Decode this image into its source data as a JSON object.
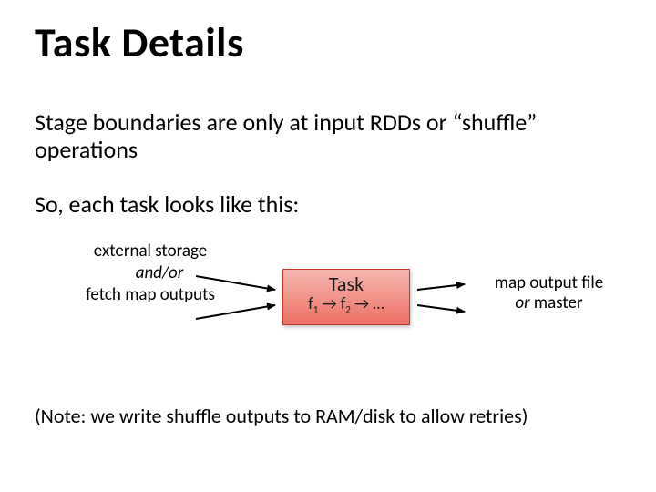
{
  "title": "Task Details",
  "body_line1": "Stage boundaries are only at input RDDs or “shuffle” operations",
  "body_line2": "So, each task looks like this:",
  "diagram": {
    "left_top": "external storage",
    "andor": "and/or",
    "left_bottom": "fetch map outputs",
    "task_label": "Task",
    "task_seq_f1": "f",
    "task_seq_sub1": "1",
    "task_seq_arrow": " → ",
    "task_seq_f2": "f",
    "task_seq_sub2": "2",
    "task_seq_tail": " → …",
    "right_line1": "map output file",
    "right_or": "or",
    "right_line2": " master"
  },
  "footnote": "(Note: we write shuffle outputs to RAM/disk to allow retries)"
}
